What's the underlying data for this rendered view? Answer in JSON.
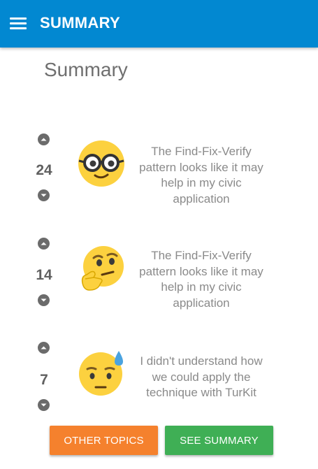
{
  "appbar": {
    "title": "SUMMARY",
    "menu_icon": "hamburger-menu-icon"
  },
  "page": {
    "title": "Summary"
  },
  "items": [
    {
      "votes": "24",
      "emoji": "nerd-face-emoji",
      "text": "The Find-Fix-Verify pattern looks like it may help in my civic application"
    },
    {
      "votes": "14",
      "emoji": "thinking-face-emoji",
      "text": "The Find-Fix-Verify pattern looks like it may help in my civic application"
    },
    {
      "votes": "7",
      "emoji": "sad-sweat-face-emoji",
      "text": "I didn't understand how we could apply the technique with TurKit"
    }
  ],
  "buttons": {
    "other_topics": "OTHER TOPICS",
    "see_summary": "SEE SUMMARY"
  },
  "colors": {
    "appbar": "#0288d1",
    "other_topics_button": "#f5812d",
    "see_summary_button": "#3faf55",
    "emoji_yellow": "#fcd13f"
  }
}
